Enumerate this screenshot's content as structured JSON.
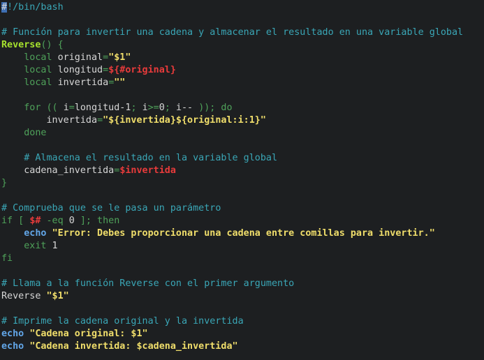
{
  "editor": {
    "colors": {
      "background": "#1d1f21",
      "comment": "#3aa7b7",
      "function_name": "#a6e22e",
      "keyword": "#4fa25a",
      "string": "#f0de6b",
      "variable": "#e83b3b",
      "builtin": "#62a6e8",
      "text": "#d7d7d7",
      "cursor": "#3f6fb3"
    },
    "lines": [
      {
        "tokens": [
          {
            "t": "#",
            "c": "cursor"
          },
          {
            "t": "!/bin/bash",
            "c": "comment"
          }
        ]
      },
      {
        "tokens": []
      },
      {
        "tokens": [
          {
            "t": "# Función para invertir una cadena y almacenar el resultado en una variable global",
            "c": "comment"
          }
        ]
      },
      {
        "tokens": [
          {
            "t": "Reverse",
            "c": "fn"
          },
          {
            "t": "() {",
            "c": "kw"
          }
        ]
      },
      {
        "tokens": [
          {
            "t": "    ",
            "c": "plain"
          },
          {
            "t": "local",
            "c": "kw"
          },
          {
            "t": " original",
            "c": "plain"
          },
          {
            "t": "=",
            "c": "op"
          },
          {
            "t": "\"$1\"",
            "c": "str"
          }
        ]
      },
      {
        "tokens": [
          {
            "t": "    ",
            "c": "plain"
          },
          {
            "t": "local",
            "c": "kw"
          },
          {
            "t": " longitud",
            "c": "plain"
          },
          {
            "t": "=",
            "c": "op"
          },
          {
            "t": "${#original}",
            "c": "var"
          }
        ]
      },
      {
        "tokens": [
          {
            "t": "    ",
            "c": "plain"
          },
          {
            "t": "local",
            "c": "kw"
          },
          {
            "t": " invertida",
            "c": "plain"
          },
          {
            "t": "=",
            "c": "op"
          },
          {
            "t": "\"\"",
            "c": "str"
          }
        ]
      },
      {
        "tokens": []
      },
      {
        "tokens": [
          {
            "t": "    ",
            "c": "plain"
          },
          {
            "t": "for",
            "c": "kw"
          },
          {
            "t": " (( ",
            "c": "kw"
          },
          {
            "t": "i",
            "c": "plain"
          },
          {
            "t": "=",
            "c": "op"
          },
          {
            "t": "longitud-1",
            "c": "plain"
          },
          {
            "t": "; ",
            "c": "kw"
          },
          {
            "t": "i",
            "c": "plain"
          },
          {
            "t": ">=",
            "c": "op"
          },
          {
            "t": "0",
            "c": "plain"
          },
          {
            "t": "; ",
            "c": "kw"
          },
          {
            "t": "i-- ",
            "c": "plain"
          },
          {
            "t": ")); do",
            "c": "kw"
          }
        ]
      },
      {
        "tokens": [
          {
            "t": "        invertida",
            "c": "plain"
          },
          {
            "t": "=",
            "c": "op"
          },
          {
            "t": "\"${invertida}${original:i:1}\"",
            "c": "str"
          }
        ]
      },
      {
        "tokens": [
          {
            "t": "    ",
            "c": "plain"
          },
          {
            "t": "done",
            "c": "kw"
          }
        ]
      },
      {
        "tokens": []
      },
      {
        "tokens": [
          {
            "t": "    ",
            "c": "plain"
          },
          {
            "t": "# Almacena el resultado en la variable global",
            "c": "comment"
          }
        ]
      },
      {
        "tokens": [
          {
            "t": "    cadena_invertida",
            "c": "plain"
          },
          {
            "t": "=",
            "c": "op"
          },
          {
            "t": "$invertida",
            "c": "var"
          }
        ]
      },
      {
        "tokens": [
          {
            "t": "}",
            "c": "kw"
          }
        ]
      },
      {
        "tokens": []
      },
      {
        "tokens": [
          {
            "t": "# Comprueba que se le pasa un parámetro",
            "c": "comment"
          }
        ]
      },
      {
        "tokens": [
          {
            "t": "if",
            "c": "kw"
          },
          {
            "t": " [ ",
            "c": "kw"
          },
          {
            "t": "$#",
            "c": "var"
          },
          {
            "t": " -eq ",
            "c": "kw"
          },
          {
            "t": "0",
            "c": "plain"
          },
          {
            "t": " ]; then",
            "c": "kw"
          }
        ]
      },
      {
        "tokens": [
          {
            "t": "    ",
            "c": "plain"
          },
          {
            "t": "echo",
            "c": "echo"
          },
          {
            "t": " ",
            "c": "plain"
          },
          {
            "t": "\"Error: Debes proporcionar una cadena entre comillas para invertir.\"",
            "c": "str"
          }
        ]
      },
      {
        "tokens": [
          {
            "t": "    ",
            "c": "plain"
          },
          {
            "t": "exit",
            "c": "kw"
          },
          {
            "t": " 1",
            "c": "plain"
          }
        ]
      },
      {
        "tokens": [
          {
            "t": "fi",
            "c": "kw"
          }
        ]
      },
      {
        "tokens": []
      },
      {
        "tokens": [
          {
            "t": "# Llama a la función Reverse con el primer argumento",
            "c": "comment"
          }
        ]
      },
      {
        "tokens": [
          {
            "t": "Reverse ",
            "c": "plain"
          },
          {
            "t": "\"$1\"",
            "c": "str"
          }
        ]
      },
      {
        "tokens": []
      },
      {
        "tokens": [
          {
            "t": "# Imprime la cadena original y la invertida",
            "c": "comment"
          }
        ]
      },
      {
        "tokens": [
          {
            "t": "echo",
            "c": "echo"
          },
          {
            "t": " ",
            "c": "plain"
          },
          {
            "t": "\"Cadena original: $1\"",
            "c": "str"
          }
        ]
      },
      {
        "tokens": [
          {
            "t": "echo",
            "c": "echo"
          },
          {
            "t": " ",
            "c": "plain"
          },
          {
            "t": "\"Cadena invertida: $cadena_invertida\"",
            "c": "str"
          }
        ]
      }
    ]
  }
}
